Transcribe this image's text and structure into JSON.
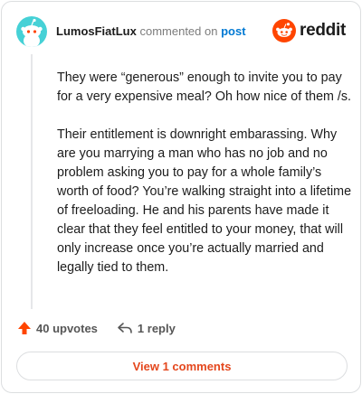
{
  "header": {
    "username": "LumosFiatLux",
    "action_text": "commented on",
    "post_link": "post",
    "brand": "reddit"
  },
  "comment": {
    "paragraphs": [
      "They were “generous” enough to invite you to pay for a very expensive meal? Oh how nice of them /s.",
      "Their entitlement is downright embarassing. Why are you marrying a man who has no job and no problem asking you to pay for a whole family’s worth of food? You’re walking straight into a lifetime of freeloading. He and his parents have made it clear that they feel entitled to your money, that will only increase once you’re actually married and legally tied to them."
    ]
  },
  "actions": {
    "upvotes_label": "40 upvotes",
    "reply_label": "1 reply",
    "view_comments_label": "View 1 comments"
  },
  "colors": {
    "brand_orange": "#ff4500",
    "upvote_orange": "#ff4500",
    "link_blue": "#0079d3",
    "avatar_bg": "#46d1d6"
  },
  "icons": [
    "avatar-snoo-icon",
    "reddit-logo-icon",
    "upvote-arrow-icon",
    "reply-arrow-icon"
  ]
}
